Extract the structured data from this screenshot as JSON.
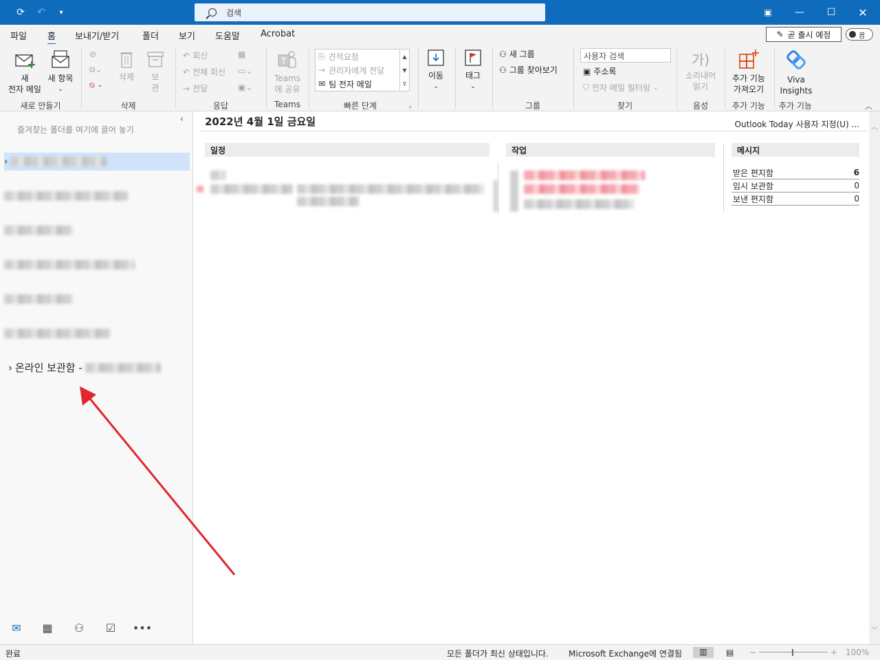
{
  "titlebar": {
    "search_placeholder": "검색"
  },
  "menu": {
    "tabs": [
      "파일",
      "홈",
      "보내기/받기",
      "폴더",
      "보기",
      "도움말",
      "Acrobat"
    ],
    "active_tab": "홈",
    "coming_soon": "곧 출시 예정",
    "toggle_label": "끔"
  },
  "ribbon": {
    "new": {
      "new_email": [
        "새",
        "전자 메일"
      ],
      "new_items": "새 항목",
      "group": "새로 만들기"
    },
    "delete": {
      "delete": "삭제",
      "archive": [
        "보",
        "관"
      ],
      "group": "삭제"
    },
    "respond": {
      "reply": "회신",
      "reply_all": "전체 회신",
      "forward": "전달",
      "group": "응답"
    },
    "teams": {
      "share": [
        "Teams",
        "에 공유"
      ],
      "group": "Teams"
    },
    "quick_steps": {
      "items": [
        "견적요청",
        "관리자에게 전달",
        "팀 전자 메일"
      ],
      "group": "빠른 단계"
    },
    "move": {
      "label": "이동"
    },
    "tags": {
      "label": "태그"
    },
    "groups": {
      "new_group": "새 그룹",
      "browse_groups": "그룹 찾아보기",
      "group": "그룹"
    },
    "find": {
      "people_search": "사용자 검색",
      "address_book": "주소록",
      "filter_email": "전자 메일 필터링",
      "group": "찾기"
    },
    "speech": {
      "read_aloud": [
        "소리내어",
        "읽기"
      ],
      "group": "음성"
    },
    "addins": {
      "get_addins": [
        "추가 기능",
        "가져오기"
      ],
      "group": "추가 기능"
    },
    "viva": {
      "label": [
        "Viva",
        "Insights"
      ],
      "group": "추가 기능"
    }
  },
  "leftpane": {
    "favorites_hint": "즐겨찾는 폴더를 여기에 끌어 놓기",
    "online_archive": "온라인 보관함 -"
  },
  "main": {
    "date_heading": "2022년 4월 1일 금요일",
    "customize": "Outlook Today 사용자 지정(U) ...",
    "calendar_head": "일정",
    "tasks_head": "작업",
    "messages_head": "메시지",
    "messages": [
      {
        "label": "받은 편지함",
        "count": "6"
      },
      {
        "label": "임시 보관함",
        "count": "0"
      },
      {
        "label": "보낸 편지함",
        "count": "0"
      }
    ]
  },
  "statusbar": {
    "left": "완료",
    "sync_status": "모든 폴더가 최신 상태입니다.",
    "connection": "Microsoft Exchange에 연결됨",
    "zoom": "100%"
  },
  "colors": {
    "titlebar": "#0f6cbd",
    "annotation_arrow": "#e0262b"
  }
}
